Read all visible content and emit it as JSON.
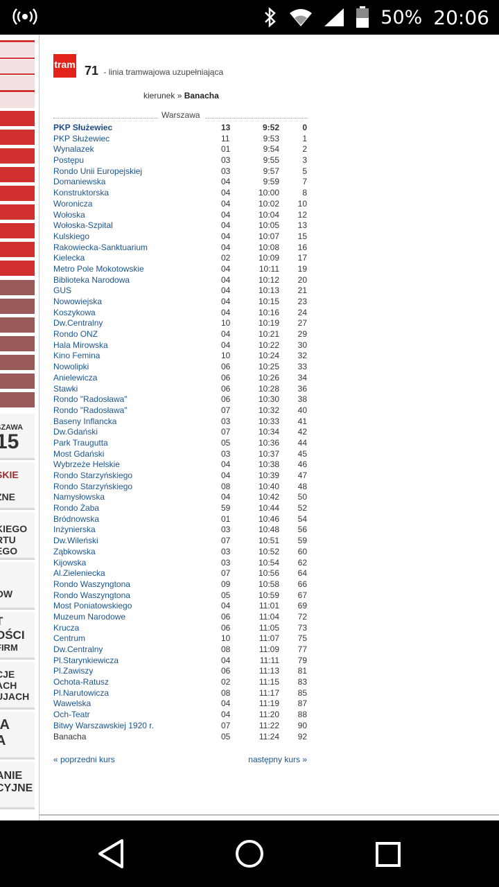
{
  "status_bar": {
    "battery": "50%",
    "time": "20:06",
    "icons": [
      "wireless-broadcast-icon",
      "bluetooth-icon",
      "wifi-icon",
      "signal-icon",
      "battery-icon"
    ]
  },
  "sidebar": {
    "ads": [
      {
        "lines": [
          "SZAWA",
          "15"
        ]
      },
      {
        "lines": [
          "SKIE",
          "ZNE"
        ]
      },
      {
        "lines": [
          "KIEGO",
          "RTU",
          "EGO"
        ]
      },
      {
        "lines": [
          "",
          "OW"
        ]
      },
      {
        "lines": [
          "T",
          "OŚCI",
          "FIRM"
        ]
      },
      {
        "lines": [
          "CJE",
          "ACH",
          "UJACH"
        ]
      },
      {
        "lines": [
          "IA",
          "A"
        ]
      },
      {
        "lines": [
          "ANIE",
          "CYJNE"
        ]
      }
    ]
  },
  "header": {
    "logo_text": "tram",
    "line_number": "71",
    "line_desc": "- linia tramwajowa uzupełniająca",
    "direction_label": "kierunek »",
    "direction_value": "Banacha",
    "city": "Warszawa"
  },
  "stops": [
    {
      "name": "PKP Służewiec",
      "zone": "13",
      "time": "9:52",
      "mins": "0"
    },
    {
      "name": "PKP Służewiec",
      "zone": "11",
      "time": "9:53",
      "mins": "1"
    },
    {
      "name": "Wynalazek",
      "zone": "01",
      "time": "9:54",
      "mins": "2"
    },
    {
      "name": "Postępu",
      "zone": "03",
      "time": "9:55",
      "mins": "3"
    },
    {
      "name": "Rondo Unii Europejskiej",
      "zone": "03",
      "time": "9:57",
      "mins": "5"
    },
    {
      "name": "Domaniewska",
      "zone": "04",
      "time": "9:59",
      "mins": "7"
    },
    {
      "name": "Konstruktorska",
      "zone": "04",
      "time": "10:00",
      "mins": "8"
    },
    {
      "name": "Woronicza",
      "zone": "04",
      "time": "10:02",
      "mins": "10"
    },
    {
      "name": "Wołoska",
      "zone": "04",
      "time": "10:04",
      "mins": "12"
    },
    {
      "name": "Wołoska-Szpital",
      "zone": "04",
      "time": "10:05",
      "mins": "13"
    },
    {
      "name": "Kulskiego",
      "zone": "04",
      "time": "10:07",
      "mins": "15"
    },
    {
      "name": "Rakowiecka-Sanktuarium",
      "zone": "04",
      "time": "10:08",
      "mins": "16"
    },
    {
      "name": "Kielecka",
      "zone": "02",
      "time": "10:09",
      "mins": "17"
    },
    {
      "name": "Metro Pole Mokotowskie",
      "zone": "04",
      "time": "10:11",
      "mins": "19"
    },
    {
      "name": "Biblioteka Narodowa",
      "zone": "04",
      "time": "10:12",
      "mins": "20"
    },
    {
      "name": "GUS",
      "zone": "04",
      "time": "10:13",
      "mins": "21"
    },
    {
      "name": "Nowowiejska",
      "zone": "04",
      "time": "10:15",
      "mins": "23"
    },
    {
      "name": "Koszykowa",
      "zone": "04",
      "time": "10:16",
      "mins": "24"
    },
    {
      "name": "Dw.Centralny",
      "zone": "10",
      "time": "10:19",
      "mins": "27"
    },
    {
      "name": "Rondo ONZ",
      "zone": "04",
      "time": "10:21",
      "mins": "29"
    },
    {
      "name": "Hala Mirowska",
      "zone": "04",
      "time": "10:22",
      "mins": "30"
    },
    {
      "name": "Kino Femina",
      "zone": "10",
      "time": "10:24",
      "mins": "32"
    },
    {
      "name": "Nowolipki",
      "zone": "06",
      "time": "10:25",
      "mins": "33"
    },
    {
      "name": "Anielewicza",
      "zone": "06",
      "time": "10:26",
      "mins": "34"
    },
    {
      "name": "Stawki",
      "zone": "06",
      "time": "10:28",
      "mins": "36"
    },
    {
      "name": "Rondo \"Radosława\"",
      "zone": "06",
      "time": "10:30",
      "mins": "38"
    },
    {
      "name": "Rondo \"Radosława\"",
      "zone": "07",
      "time": "10:32",
      "mins": "40"
    },
    {
      "name": "Baseny Inflancka",
      "zone": "03",
      "time": "10:33",
      "mins": "41"
    },
    {
      "name": "Dw.Gdański",
      "zone": "07",
      "time": "10:34",
      "mins": "42"
    },
    {
      "name": "Park Traugutta",
      "zone": "05",
      "time": "10:36",
      "mins": "44"
    },
    {
      "name": "Most Gdański",
      "zone": "03",
      "time": "10:37",
      "mins": "45"
    },
    {
      "name": "Wybrzeże Helskie",
      "zone": "04",
      "time": "10:38",
      "mins": "46"
    },
    {
      "name": "Rondo Starzyńskiego",
      "zone": "04",
      "time": "10:39",
      "mins": "47"
    },
    {
      "name": "Rondo Starzyńskiego",
      "zone": "08",
      "time": "10:40",
      "mins": "48"
    },
    {
      "name": "Namysłowska",
      "zone": "04",
      "time": "10:42",
      "mins": "50"
    },
    {
      "name": "Rondo Żaba",
      "zone": "59",
      "time": "10:44",
      "mins": "52"
    },
    {
      "name": "Bródnowska",
      "zone": "01",
      "time": "10:46",
      "mins": "54"
    },
    {
      "name": "Inżynierska",
      "zone": "03",
      "time": "10:48",
      "mins": "56"
    },
    {
      "name": "Dw.Wileński",
      "zone": "07",
      "time": "10:51",
      "mins": "59"
    },
    {
      "name": "Ząbkowska",
      "zone": "03",
      "time": "10:52",
      "mins": "60"
    },
    {
      "name": "Kijowska",
      "zone": "03",
      "time": "10:54",
      "mins": "62"
    },
    {
      "name": "Al.Zieleniecka",
      "zone": "07",
      "time": "10:56",
      "mins": "64"
    },
    {
      "name": "Rondo Waszyngtona",
      "zone": "09",
      "time": "10:58",
      "mins": "66"
    },
    {
      "name": "Rondo Waszyngtona",
      "zone": "05",
      "time": "10:59",
      "mins": "67"
    },
    {
      "name": "Most Poniatowskiego",
      "zone": "04",
      "time": "11:01",
      "mins": "69"
    },
    {
      "name": "Muzeum Narodowe",
      "zone": "06",
      "time": "11:04",
      "mins": "72"
    },
    {
      "name": "Krucza",
      "zone": "06",
      "time": "11:05",
      "mins": "73"
    },
    {
      "name": "Centrum",
      "zone": "10",
      "time": "11:07",
      "mins": "75"
    },
    {
      "name": "Dw.Centralny",
      "zone": "08",
      "time": "11:09",
      "mins": "77"
    },
    {
      "name": "Pl.Starynkiewicza",
      "zone": "04",
      "time": "11:11",
      "mins": "79"
    },
    {
      "name": "Pl.Zawiszy",
      "zone": "06",
      "time": "11:13",
      "mins": "81"
    },
    {
      "name": "Ochota-Ratusz",
      "zone": "02",
      "time": "11:15",
      "mins": "83"
    },
    {
      "name": "Pl.Narutowicza",
      "zone": "08",
      "time": "11:17",
      "mins": "85"
    },
    {
      "name": "Wawelska",
      "zone": "04",
      "time": "11:19",
      "mins": "87"
    },
    {
      "name": "Och-Teatr",
      "zone": "04",
      "time": "11:20",
      "mins": "88"
    },
    {
      "name": "Bitwy Warszawskiej 1920 r.",
      "zone": "07",
      "time": "11:22",
      "mins": "90"
    },
    {
      "name": "Banacha",
      "zone": "05",
      "time": "11:24",
      "mins": "92"
    }
  ],
  "nav": {
    "prev": "« poprzedni kurs",
    "next": "następny kurs »"
  },
  "colors": {
    "link": "#1a5490",
    "tram_red": "#e2231a",
    "sidebar_red": "#d03030",
    "sidebar_brown": "#9b5a5a"
  }
}
